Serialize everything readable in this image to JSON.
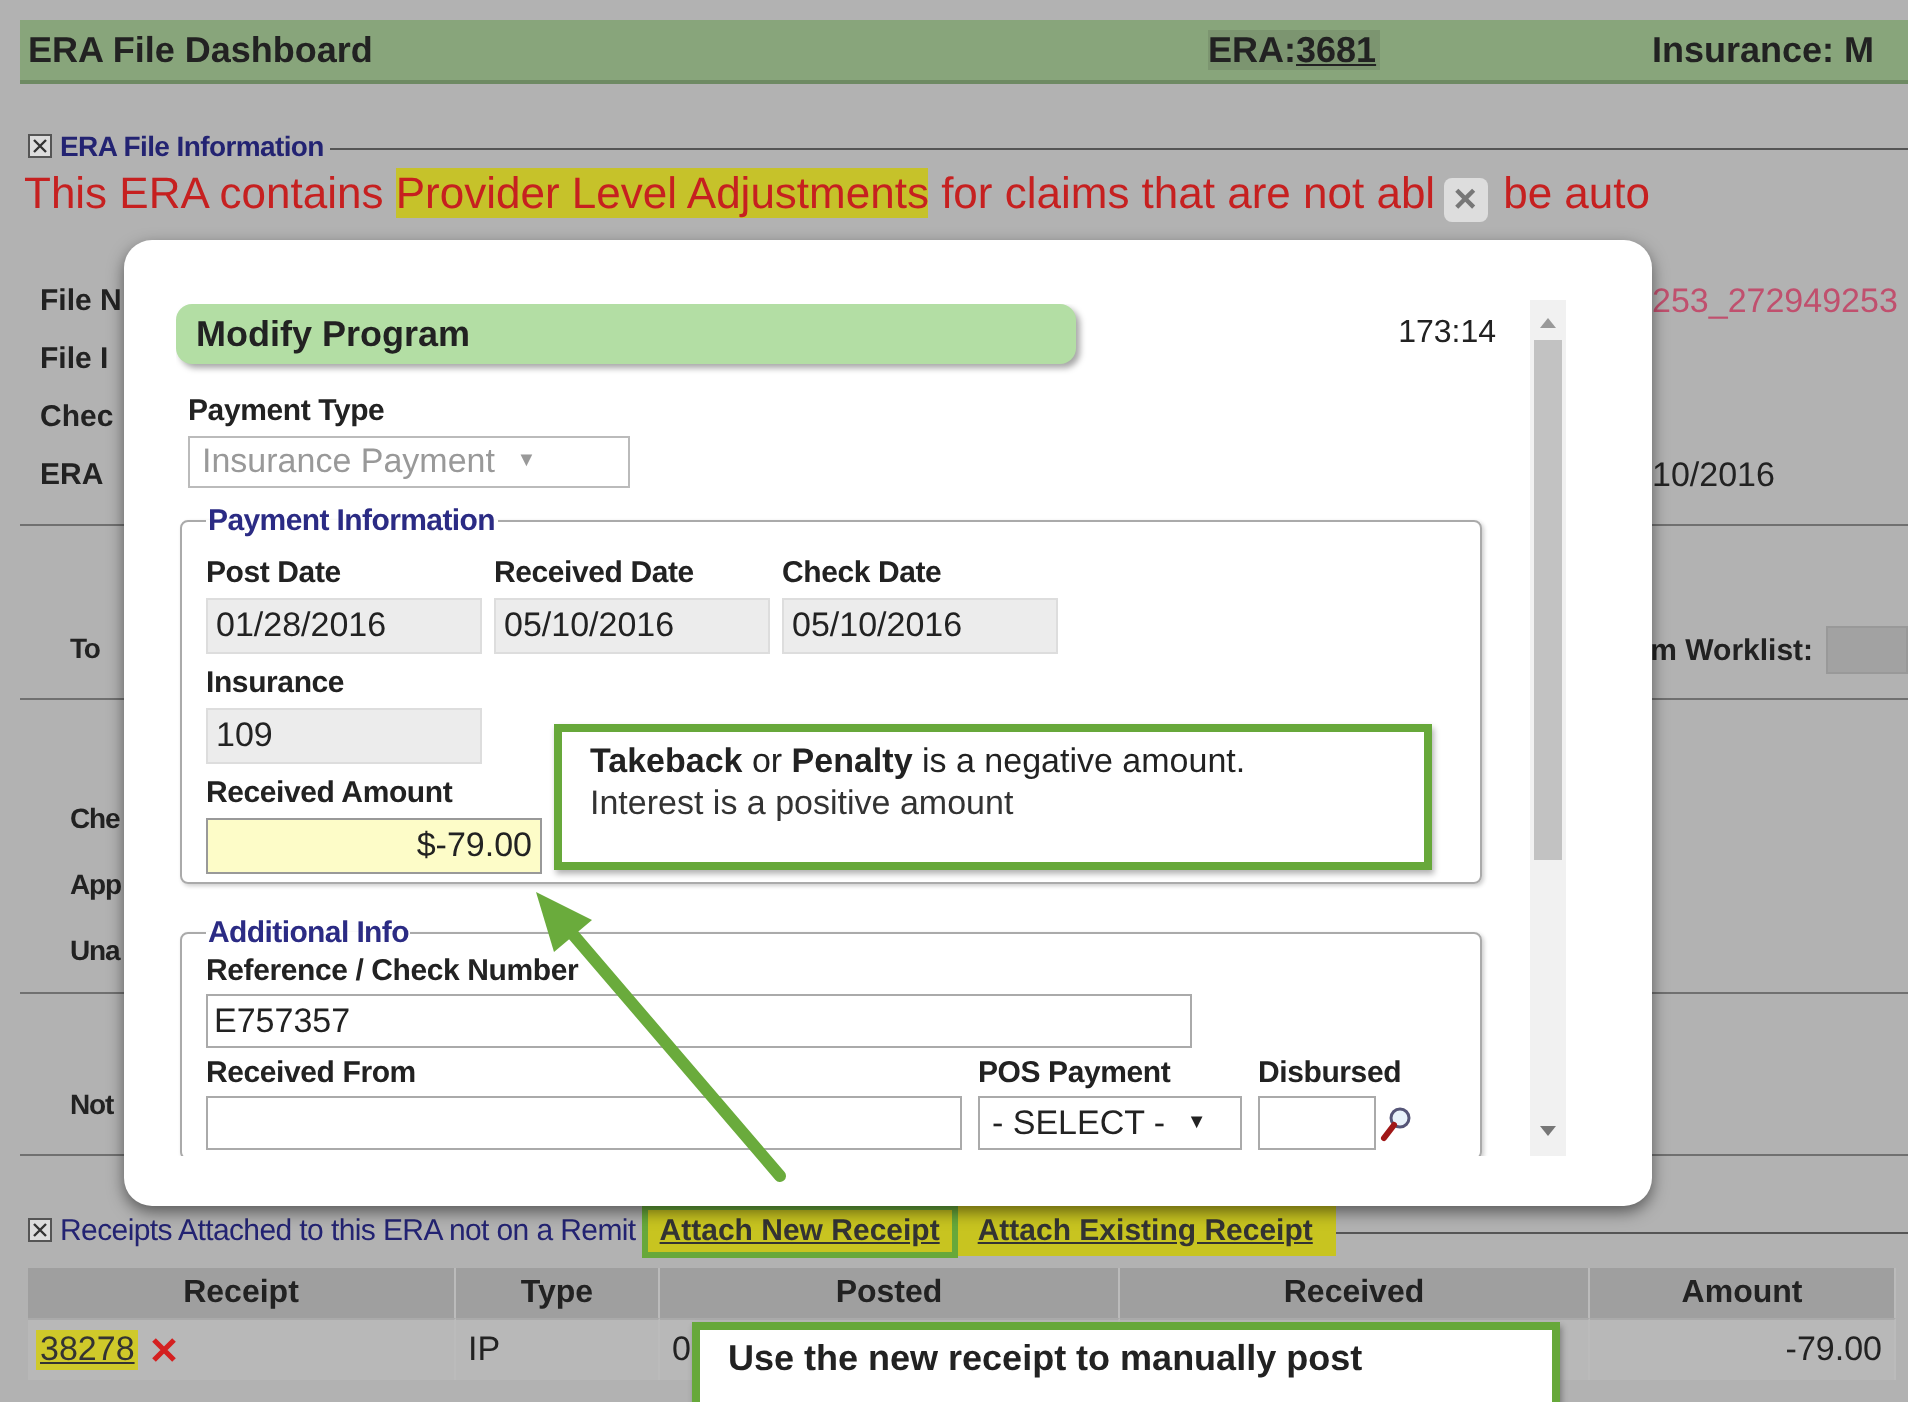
{
  "header": {
    "title": "ERA File Dashboard",
    "era_label": "ERA:",
    "era_number": "3681",
    "insurance": "Insurance: M"
  },
  "era_info": {
    "legend": "ERA File Information",
    "message": [
      {
        "text": "This ERA contains ",
        "highlighted": false
      },
      {
        "text": "Provider Level Adjustments",
        "highlighted": true
      },
      {
        "text": " for claims that are not abl",
        "highlighted": false
      }
    ],
    "close_glyph": "×",
    "message_tail": "be auto",
    "groups": [
      [
        {
          "label": "File N",
          "value": "253_272949253"
        },
        {
          "label": "File I"
        },
        {
          "label": "Chec"
        },
        {
          "label": "ERA",
          "value": "10/2016"
        }
      ],
      [
        {
          "label": "To",
          "value": "m Worklist:",
          "field": true
        }
      ],
      [
        {
          "label": "Che"
        },
        {
          "label": "App"
        },
        {
          "label": "Una"
        }
      ],
      [
        {
          "label": "Not"
        }
      ]
    ]
  },
  "modal": {
    "title": "Modify Program",
    "timer": "173:14",
    "caret_glyph": "▼",
    "payment_type": {
      "label": "Payment Type",
      "value": "Insurance Payment",
      "disabled": true
    },
    "payment_info": {
      "legend": "Payment Information",
      "dates": [
        {
          "label": "Post Date",
          "value": "01/28/2016"
        },
        {
          "label": "Received Date",
          "value": "05/10/2016"
        },
        {
          "label": "Check Date",
          "value": "05/10/2016"
        }
      ],
      "insurance": {
        "label": "Insurance",
        "value": "109"
      },
      "received_amount": {
        "label": "Received Amount",
        "value": "$-79.00"
      }
    },
    "additional_info": {
      "legend": "Additional Info",
      "reference": {
        "label": "Reference / Check Number",
        "value": "E757357"
      },
      "received_from": {
        "label": "Received From"
      },
      "pos_payment": {
        "label": "POS Payment",
        "value": "- SELECT -"
      },
      "disbursed": {
        "label": "Disbursed"
      }
    }
  },
  "amount_callout": [
    "**Takeback** or **Penalty**  is a negative amount.",
    "Interest  is a positive amount"
  ],
  "receipts": {
    "legend": "Receipts Attached to this ERA not on a Remit",
    "links": [
      {
        "label": "Attach New Receipt",
        "outlined": true
      },
      {
        "label": "Attach Existing Receipt",
        "outlined": false
      }
    ],
    "columns": [
      "Receipt",
      "Type",
      "Posted",
      "Received",
      "Amount"
    ],
    "rows": [
      {
        "receipt": "38278",
        "type": "IP",
        "posted": "0",
        "amount": "-79.00"
      }
    ]
  },
  "receipt_callout": "Use the new receipt to manually post"
}
